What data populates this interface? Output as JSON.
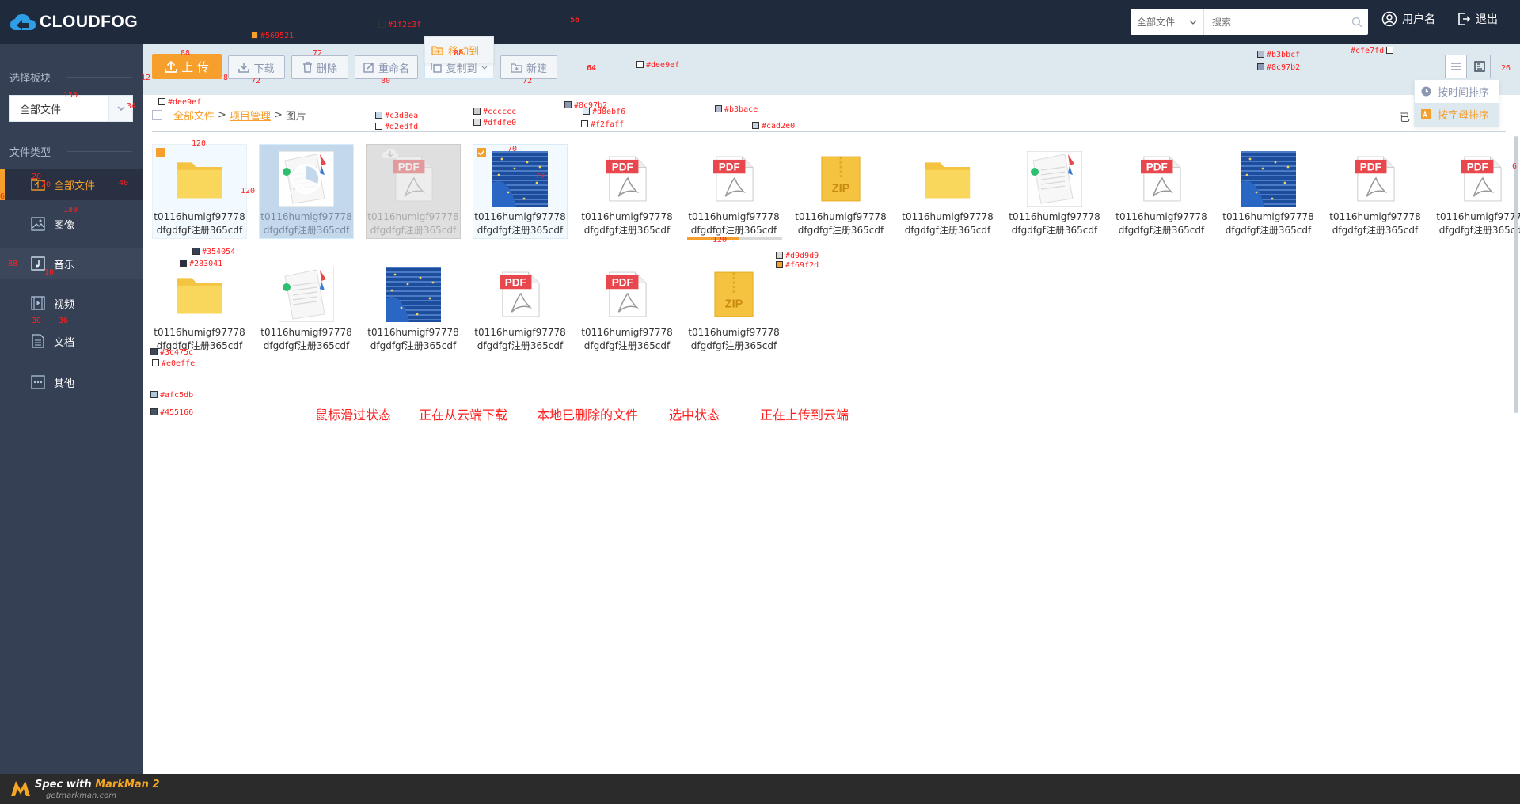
{
  "app": {
    "logo_text": "CLOUDFOG"
  },
  "header": {
    "search_scope": "全部文件",
    "search_placeholder": "搜索",
    "username": "用户名",
    "logout": "退出"
  },
  "sidebar": {
    "select_section_title": "选择板块",
    "select_value": "全部文件",
    "filetype_section_title": "文件类型",
    "items": [
      {
        "label": "全部文件",
        "icon": "all-files-icon",
        "state": "active"
      },
      {
        "label": "图像",
        "icon": "image-icon",
        "state": "normal"
      },
      {
        "label": "音乐",
        "icon": "music-icon",
        "state": "hover"
      },
      {
        "label": "视频",
        "icon": "video-icon",
        "state": "normal"
      },
      {
        "label": "文档",
        "icon": "document-icon",
        "state": "normal"
      },
      {
        "label": "其他",
        "icon": "other-icon",
        "state": "normal"
      }
    ]
  },
  "toolbar": {
    "upload": "上 传",
    "download": "下载",
    "delete": "删除",
    "rename": "重命名",
    "copy_to": "复制到",
    "new": "新建",
    "move_to": "移动到"
  },
  "sort_menu": {
    "by_time": "按时间排序",
    "by_letter": "按字母排序"
  },
  "breadcrumb": {
    "root": "全部文件",
    "sep": ">",
    "level1": "项目管理",
    "level2": "图片"
  },
  "status_right": "已",
  "files": [
    {
      "line1": "t0116humigf97778",
      "line2": "dfgdfgf注册365cdf",
      "type": "folder",
      "state": "hover"
    },
    {
      "line1": "t0116humigf97778",
      "line2": "dfgdfgf注册365cdf",
      "type": "doc-image",
      "state": "downloading"
    },
    {
      "line1": "t0116humigf97778",
      "line2": "dfgdfgf注册365cdf",
      "type": "pdf",
      "state": "deleted"
    },
    {
      "line1": "t0116humigf97778",
      "line2": "dfgdfgf注册365cdf",
      "type": "photo",
      "state": "selected"
    },
    {
      "line1": "t0116humigf97778",
      "line2": "dfgdfgf注册365cdf",
      "type": "pdf",
      "state": "normal"
    },
    {
      "line1": "t0116humigf97778",
      "line2": "dfgdfgf注册365cdf",
      "type": "pdf",
      "state": "uploading",
      "progress": 0.55
    },
    {
      "line1": "t0116humigf97778",
      "line2": "dfgdfgf注册365cdf",
      "type": "zip",
      "state": "normal"
    },
    {
      "line1": "t0116humigf97778",
      "line2": "dfgdfgf注册365cdf",
      "type": "folder",
      "state": "normal"
    },
    {
      "line1": "t0116humigf97778",
      "line2": "dfgdfgf注册365cdf",
      "type": "doc-image",
      "state": "normal"
    },
    {
      "line1": "t0116humigf97778",
      "line2": "dfgdfgf注册365cdf",
      "type": "pdf",
      "state": "normal"
    },
    {
      "line1": "t0116humigf97778",
      "line2": "dfgdfgf注册365cdf",
      "type": "photo",
      "state": "normal"
    },
    {
      "line1": "t0116humigf97778",
      "line2": "dfgdfgf注册365cdf",
      "type": "pdf",
      "state": "normal"
    },
    {
      "line1": "t0116humigf97778",
      "line2": "dfgdfgf注册365cdf",
      "type": "pdf",
      "state": "normal"
    },
    {
      "line1": "t0116humigf97778",
      "line2": "dfgdfgf注册365cdf",
      "type": "folder",
      "state": "normal"
    },
    {
      "line1": "t0116humigf97778",
      "line2": "dfgdfgf注册365cdf",
      "type": "doc-image",
      "state": "normal"
    },
    {
      "line1": "t0116humigf97778",
      "line2": "dfgdfgf注册365cdf",
      "type": "photo",
      "state": "normal"
    },
    {
      "line1": "t0116humigf97778",
      "line2": "dfgdfgf注册365cdf",
      "type": "pdf",
      "state": "normal"
    },
    {
      "line1": "t0116humigf97778",
      "line2": "dfgdfgf注册365cdf",
      "type": "pdf",
      "state": "normal"
    },
    {
      "line1": "t0116humigf97778",
      "line2": "dfgdfgf注册365cdf",
      "type": "zip",
      "state": "normal"
    }
  ],
  "captions": {
    "hover": "鼠标滑过状态",
    "downloading": "正在从云端下载",
    "deleted": "本地已删除的文件",
    "selected": "选中状态",
    "uploading": "正在上传到云端"
  },
  "annotations": {
    "c1": "#569521",
    "c2": "#1f2c3f",
    "c3": "#dee9ef",
    "c4": "#b3bbcf",
    "c5": "#8c97b2",
    "c6": "#cfe7fd",
    "c7": "#dee9ef",
    "c8": "#b3bace",
    "c9": "#c3d8ea",
    "c10": "#d2edfd",
    "c11": "#cccccc",
    "c12": "#dfdfe0",
    "c13": "#d8ebf6",
    "c14": "#f2faff",
    "c15": "#8c97b2",
    "c16": "#cad2e0",
    "c17": "#354054",
    "c18": "#283041",
    "c19": "#3c475c",
    "c20": "#e0effe",
    "c21": "#afc5db",
    "c22": "#455166",
    "c23": "#d9d9d9",
    "c24": "#f69f2d",
    "n56": "56",
    "n64": "64",
    "n88a": "88",
    "n72a": "72",
    "n88b": "88",
    "n72b": "72",
    "n80": "80",
    "n8": "8",
    "n12": "12",
    "n156": "156",
    "n34": "34",
    "n120a": "120",
    "n120b": "120",
    "n70a": "70",
    "n70b": "70",
    "n20a": "20",
    "n20b": "20",
    "n40": "40",
    "n180": "180",
    "n38": "38",
    "n10": "10",
    "n30": "30",
    "n36": "36",
    "n26": "26",
    "n120c": "120",
    "n6": "6",
    "n6b": "6"
  },
  "markman": {
    "line1a": "Spec with ",
    "line1b": "MarkMan 2",
    "line2": "getmarkman.com"
  },
  "colors": {
    "brand_orange": "#f69f2d",
    "header_bg": "#1f2a3c",
    "sidebar_bg": "#354054",
    "toolbar_bg": "#dee9ef"
  }
}
